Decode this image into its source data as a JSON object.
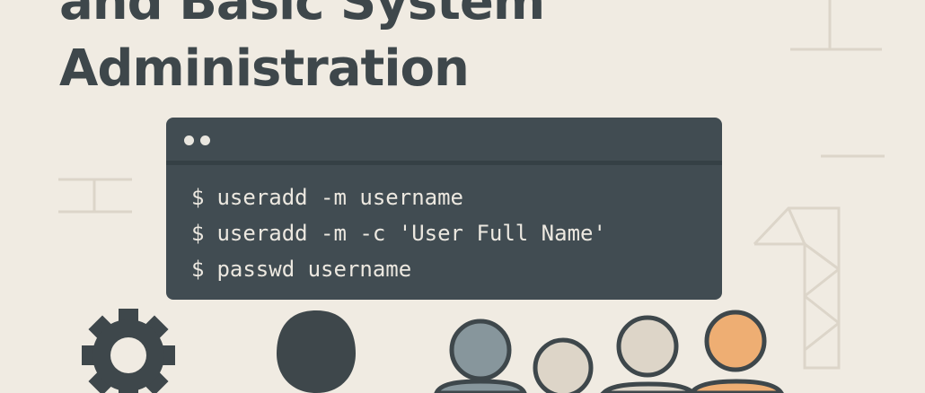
{
  "title": {
    "line1": "and Basic System",
    "line2": "Administration"
  },
  "terminal": {
    "prompt_symbol": "$",
    "lines": [
      "useradd -m username",
      "useradd -m -c 'User Full Name'",
      "passwd username"
    ]
  },
  "icons": [
    "gear-icon",
    "user-silhouette-icon",
    "user-group-icon"
  ],
  "colors": {
    "background": "#f0ebe2",
    "terminal_bg": "#414c52",
    "title": "#3e474b",
    "accent_orange": "#eeae73",
    "user_gray": "#87969c",
    "user_light": "#ddd5c8"
  }
}
